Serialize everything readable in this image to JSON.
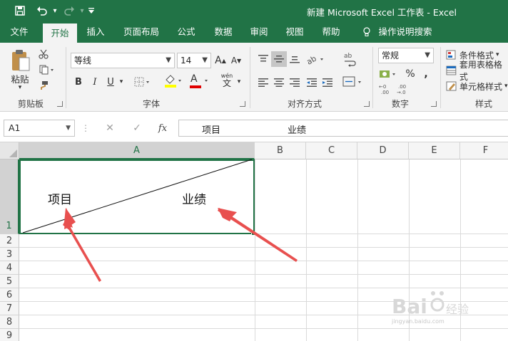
{
  "title_bar": {
    "document_title": "新建 Microsoft Excel 工作表  -  Excel",
    "qat": {
      "save_icon": "save-icon",
      "undo_icon": "undo-icon",
      "redo_icon": "redo-icon",
      "customize_icon": "chevron-down-icon"
    }
  },
  "tabs": [
    "文件",
    "开始",
    "插入",
    "页面布局",
    "公式",
    "数据",
    "审阅",
    "视图",
    "帮助",
    "操作说明搜索"
  ],
  "active_tab": "开始",
  "ribbon": {
    "clipboard": {
      "paste_label": "粘贴",
      "group_label": "剪贴板"
    },
    "font": {
      "font_name": "等线",
      "font_size": "14",
      "increase_size": "A",
      "decrease_size": "A",
      "bold": "B",
      "italic": "I",
      "underline": "U",
      "font_color_glyph": "A",
      "phonetic_glyph": "wén",
      "phonetic_char": "文",
      "group_label": "字体"
    },
    "alignment": {
      "wrap_glyph": "ab",
      "group_label": "对齐方式"
    },
    "number": {
      "format": "常规",
      "percent": "%",
      "comma": ",",
      "group_label": "数字"
    },
    "styles": {
      "conditional_format": "条件格式",
      "format_as_table": "套用表格格式",
      "cell_styles": "单元格样式",
      "group_label": "样式"
    }
  },
  "formula_bar": {
    "name_box": "A1",
    "fx": "fx",
    "content_item": "项目",
    "content_score": "业绩"
  },
  "grid": {
    "columns": [
      "A",
      "B",
      "C",
      "D",
      "E",
      "F"
    ],
    "rows": [
      "1",
      "2",
      "3",
      "4",
      "5",
      "6",
      "7",
      "8",
      "9"
    ],
    "selected_column": "A",
    "selected_row": "1",
    "cell_a1": {
      "top_right_text": "业绩",
      "bottom_left_text": "项目",
      "diagonal_border": true
    }
  },
  "annotations": {
    "arrow_color": "#e8504f",
    "count": 2
  },
  "watermark": {
    "text": "Baidu经验",
    "sub": "jingyan.baidu.com"
  },
  "colors": {
    "accent": "#217346",
    "ribbon_bg": "#f3f3f3",
    "arrow": "#e8504f"
  }
}
